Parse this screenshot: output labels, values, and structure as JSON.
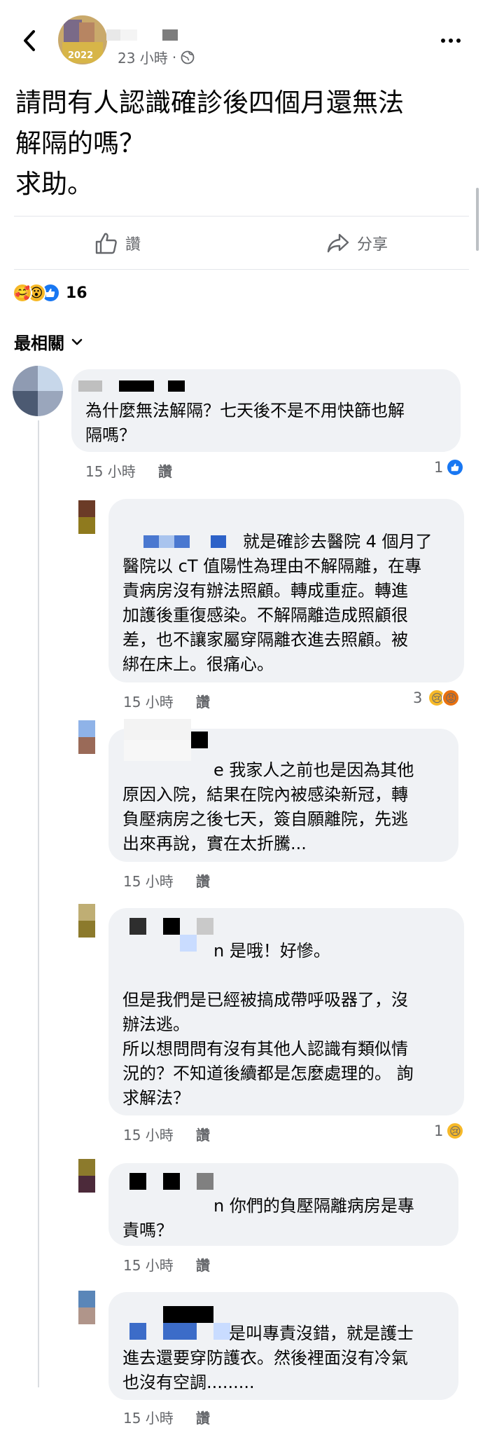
{
  "header": {
    "time": "23 小時",
    "separator": "·",
    "avatar_year": "2022"
  },
  "post": {
    "text": "請問有人認識確診後四個月還無法\n解隔的嗎？\n求助。"
  },
  "actions": {
    "like": "讚",
    "share": "分享"
  },
  "reactions": {
    "count": "16",
    "icons": [
      "care-emoji",
      "wow-emoji",
      "like-emoji"
    ]
  },
  "sort": {
    "label": "最相關"
  },
  "comments": [
    {
      "text": "為什麼無法解隔？七天後不是不用快篩也解\n隔嗎？",
      "time": "15 小時",
      "like": "讚",
      "reaction_count": "1"
    },
    {
      "text": "就是確診去醫院 4 個月了\n醫院以 cT 值陽性為理由不解隔離，在專\n責病房沒有辦法照顧。轉成重症。轉進\n加護後重復感染。不解隔離造成照顧很\n差，也不讓家屬穿隔離衣進去照顧。被\n綁在床上。很痛心。",
      "time": "15 小時",
      "like": "讚",
      "reaction_count": "3"
    },
    {
      "text": "e 我家人之前也是因為其他\n原因入院，結果在院內被感染新冠，轉\n負壓病房之後七天，簽自願離院，先逃\n出來再說，實在太折騰...",
      "time": "15 小時",
      "like": "讚"
    },
    {
      "text_first": "n 是哦！好慘。",
      "text": "但是我們是已經被搞成帶呼吸器了，沒\n辦法逃。\n所以想問問有沒有其他人認識有類似情\n況的？不知道後續都是怎麼處理的。 詢\n求解法？",
      "time": "15 小時",
      "like": "讚",
      "reaction_count": "1"
    },
    {
      "text": "n 你們的負壓隔離病房是專\n責嗎？",
      "time": "15 小時",
      "like": "讚"
    },
    {
      "text": "是叫專責沒錯，就是護士\n進去還要穿防護衣。然後裡面沒有冷氣\n也沒有空調.........",
      "time": "15 小時",
      "like": "讚"
    }
  ]
}
